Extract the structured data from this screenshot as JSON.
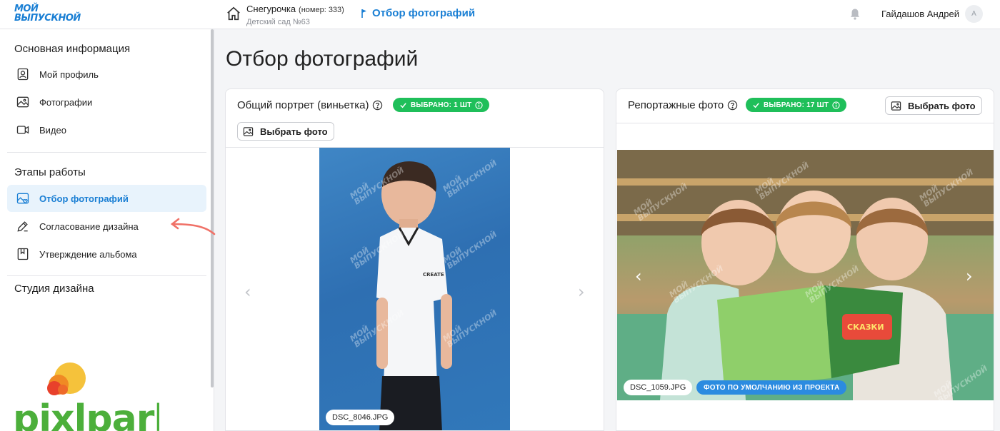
{
  "header": {
    "logo_line1": "МОЙ",
    "logo_line2": "ВЫПУСКНОЙ",
    "project_name": "Снегурочка",
    "project_number": "(номер: 333)",
    "project_org": "Детский сад №63",
    "current_page": "Отбор фотографий",
    "user_name": "Гайдашов Андрей",
    "user_initial": "А"
  },
  "sidebar": {
    "section_main": "Основная информация",
    "items_main": [
      {
        "label": "Мой профиль",
        "icon": "profile-icon"
      },
      {
        "label": "Фотографии",
        "icon": "image-icon"
      },
      {
        "label": "Видео",
        "icon": "video-icon"
      }
    ],
    "section_stages": "Этапы работы",
    "items_stages": [
      {
        "label": "Отбор фотографий",
        "icon": "photo-select-icon",
        "active": true
      },
      {
        "label": "Согласование дизайна",
        "icon": "pencil-icon"
      },
      {
        "label": "Утверждение альбома",
        "icon": "bookmark-icon"
      }
    ],
    "section_studio": "Студия дизайна",
    "brand_logo_text": "pixlpark"
  },
  "main": {
    "title": "Отбор фотографий",
    "cards": [
      {
        "title": "Общий портрет (виньетка)",
        "badge": "ВЫБРАНО: 1 ШТ",
        "button": "Выбрать фото",
        "filename": "DSC_8046.JPG"
      },
      {
        "title": "Репортажные фото",
        "badge": "ВЫБРАНО: 17 ШТ",
        "button": "Выбрать фото",
        "filename": "DSC_1059.JPG",
        "tag": "ФОТО ПО УМОЛЧАНИЮ ИЗ ПРОЕКТА"
      }
    ]
  },
  "colors": {
    "accent": "#1a7fd4",
    "success": "#1fbf5a",
    "active_bg": "#e8f3fc",
    "annotation_arrow": "#f07167"
  }
}
